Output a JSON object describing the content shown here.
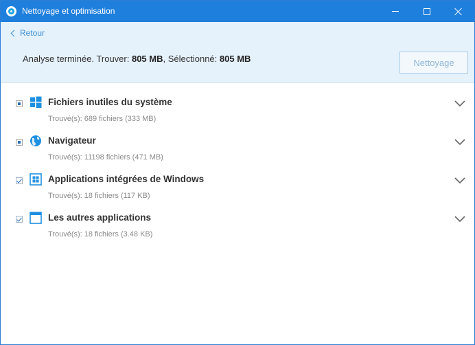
{
  "window": {
    "title": "Nettoyage et optimisation"
  },
  "header": {
    "back_label": "Retour",
    "summary_prefix": "Analyse terminée. Trouver: ",
    "found_size": "805 MB",
    "summary_middle": ", Sélectionné: ",
    "selected_size": "805 MB",
    "clean_button": "Nettoyage"
  },
  "items": [
    {
      "title": "Fichiers inutiles du système",
      "subtitle": "Trouvé(s): 689 fichiers (333 MB)",
      "check_state": "partial",
      "icon": "windows-logo-icon"
    },
    {
      "title": "Navigateur",
      "subtitle": "Trouvé(s): 11198 fichiers (471 MB)",
      "check_state": "partial",
      "icon": "globe-icon"
    },
    {
      "title": "Applications intégrées de Windows",
      "subtitle": "Trouvé(s): 18 fichiers (117 KB)",
      "check_state": "checked",
      "icon": "windows-apps-icon"
    },
    {
      "title": "Les autres applications",
      "subtitle": "Trouvé(s): 18 fichiers (3.48 KB)",
      "check_state": "checked",
      "icon": "app-window-icon"
    }
  ],
  "colors": {
    "titlebar": "#1f7fdc",
    "header_band": "#e5f1fb",
    "accent": "#3a8fd6",
    "icon_blue": "#1e90e0"
  }
}
